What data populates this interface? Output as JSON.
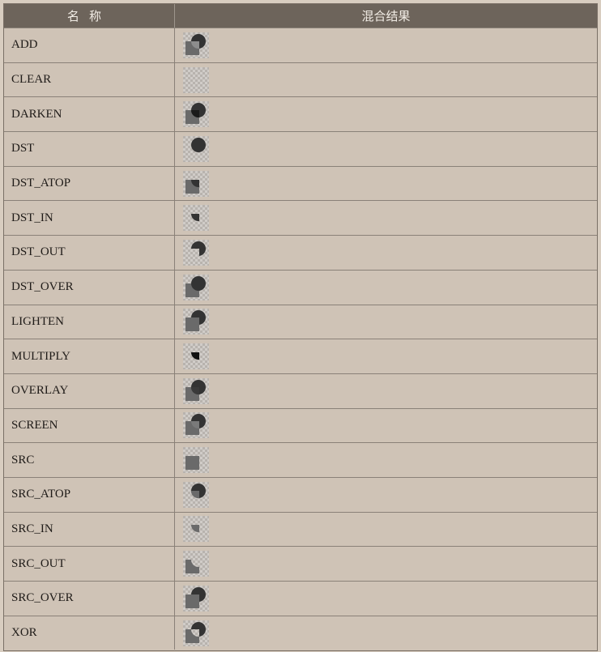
{
  "table": {
    "header": {
      "name_col": "名称",
      "result_col": "混合结果"
    },
    "rows": [
      {
        "name": "ADD",
        "result_icon": "add-result-icon"
      },
      {
        "name": "CLEAR",
        "result_icon": "clear-result-icon"
      },
      {
        "name": "DARKEN",
        "result_icon": "darken-result-icon"
      },
      {
        "name": "DST",
        "result_icon": "dst-result-icon"
      },
      {
        "name": "DST_ATOP",
        "result_icon": "dst-atop-result-icon"
      },
      {
        "name": "DST_IN",
        "result_icon": "dst-in-result-icon"
      },
      {
        "name": "DST_OUT",
        "result_icon": "dst-out-result-icon"
      },
      {
        "name": "DST_OVER",
        "result_icon": "dst-over-result-icon"
      },
      {
        "name": "LIGHTEN",
        "result_icon": "lighten-result-icon"
      },
      {
        "name": "MULTIPLY",
        "result_icon": "multiply-result-icon"
      },
      {
        "name": "OVERLAY",
        "result_icon": "overlay-result-icon"
      },
      {
        "name": "SCREEN",
        "result_icon": "screen-result-icon"
      },
      {
        "name": "SRC",
        "result_icon": "src-result-icon"
      },
      {
        "name": "SRC_ATOP",
        "result_icon": "src-atop-result-icon"
      },
      {
        "name": "SRC_IN",
        "result_icon": "src-in-result-icon"
      },
      {
        "name": "SRC_OUT",
        "result_icon": "src-out-result-icon"
      },
      {
        "name": "SRC_OVER",
        "result_icon": "src-over-result-icon"
      },
      {
        "name": "XOR",
        "result_icon": "xor-result-icon"
      }
    ]
  },
  "colors": {
    "header_bg": "#6d645b",
    "row_bg": "#cfc3b6",
    "dst_circle": "#333333",
    "src_square": "#6a6a6a",
    "checker_light": "#d0ccc8",
    "checker_dark": "#b8b3ae"
  }
}
